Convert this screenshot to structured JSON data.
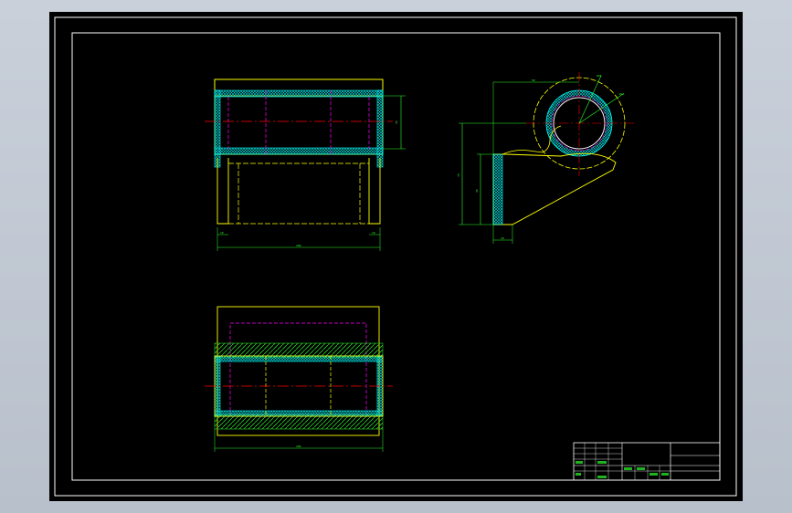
{
  "drawing": {
    "title": "",
    "front_view": {
      "dim_height": "30",
      "dim_width": "100",
      "dim_wall_left": "10",
      "dim_wall_right": "10"
    },
    "side_view": {
      "dim_top": "50",
      "dim_height_total": "70",
      "dim_height_inner": "40",
      "dim_base": "10",
      "dim_radius_outer": "R20",
      "dim_radius_inner": "R15"
    },
    "top_view": {
      "dim_width": "100"
    }
  },
  "colors": {
    "background": "#000000",
    "border": "#ffffff",
    "outline": "#ffff00",
    "hatch": "#00ffff",
    "centerline": "#ff0000",
    "hidden": "#ff00ff",
    "dimension": "#2cff2c"
  }
}
